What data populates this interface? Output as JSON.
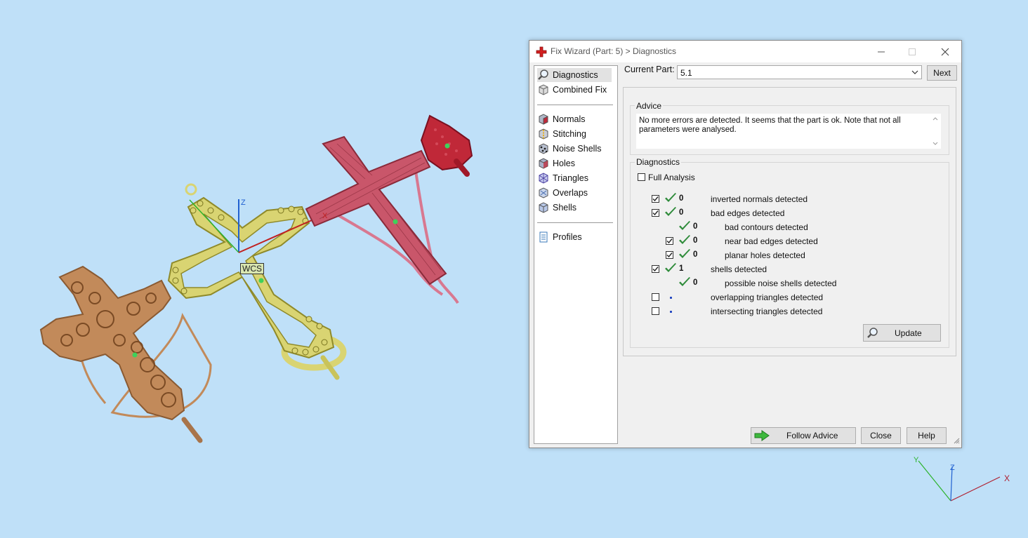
{
  "viewport": {
    "wcs_label": "WCS",
    "axis": {
      "x": "X",
      "y": "Y",
      "z": "Z"
    },
    "model_colors": {
      "wood": "#c28a5a",
      "gold": "#d9d472",
      "pink": "#c9566a",
      "red": "#c02838"
    }
  },
  "dialog": {
    "title": "Fix Wizard (Part: 5) > Diagnostics",
    "sidebar": {
      "items": [
        {
          "label": "Diagnostics",
          "icon": "magnifier-icon"
        },
        {
          "label": "Combined Fix",
          "icon": "cube-icon"
        },
        {
          "label": "Normals",
          "icon": "normals-icon"
        },
        {
          "label": "Stitching",
          "icon": "stitching-icon"
        },
        {
          "label": "Noise Shells",
          "icon": "noise-shells-icon"
        },
        {
          "label": "Holes",
          "icon": "holes-icon"
        },
        {
          "label": "Triangles",
          "icon": "triangles-icon"
        },
        {
          "label": "Overlaps",
          "icon": "overlaps-icon"
        },
        {
          "label": "Shells",
          "icon": "shells-icon"
        },
        {
          "label": "Profiles",
          "icon": "profiles-icon"
        }
      ]
    },
    "current_part_label": "Current Part:",
    "current_part_value": "5.1",
    "next_button": "Next",
    "advice": {
      "title": "Advice",
      "text": "No more errors are detected. It seems that the part is ok. Note that not all parameters were analysed."
    },
    "diagnostics": {
      "title": "Diagnostics",
      "full_analysis_label": "Full Analysis",
      "full_analysis_checked": false,
      "rows": [
        {
          "checkbox": true,
          "checked": true,
          "status": "ok",
          "count": "0",
          "label": "inverted normals detected",
          "indent": 0
        },
        {
          "checkbox": true,
          "checked": true,
          "status": "ok",
          "count": "0",
          "label": "bad edges detected",
          "indent": 0
        },
        {
          "checkbox": false,
          "checked": false,
          "status": "ok",
          "count": "0",
          "label": "bad contours detected",
          "indent": 1
        },
        {
          "checkbox": true,
          "checked": true,
          "status": "ok",
          "count": "0",
          "label": "near bad edges detected",
          "indent": 1
        },
        {
          "checkbox": true,
          "checked": true,
          "status": "ok",
          "count": "0",
          "label": "planar holes detected",
          "indent": 1
        },
        {
          "checkbox": true,
          "checked": true,
          "status": "ok",
          "count": "1",
          "label": "shells detected",
          "indent": 0
        },
        {
          "checkbox": false,
          "checked": false,
          "status": "ok",
          "count": "0",
          "label": "possible noise shells detected",
          "indent": 1
        },
        {
          "checkbox": true,
          "checked": false,
          "status": "none",
          "count": "",
          "label": "overlapping triangles detected",
          "indent": 0
        },
        {
          "checkbox": true,
          "checked": false,
          "status": "none",
          "count": "",
          "label": "intersecting triangles detected",
          "indent": 0
        }
      ],
      "update_button": "Update"
    },
    "follow_advice_button": "Follow Advice",
    "close_button": "Close",
    "help_button": "Help",
    "colors": {
      "check_green": "#2e8b3a",
      "accent_red": "#d21f1f"
    }
  }
}
